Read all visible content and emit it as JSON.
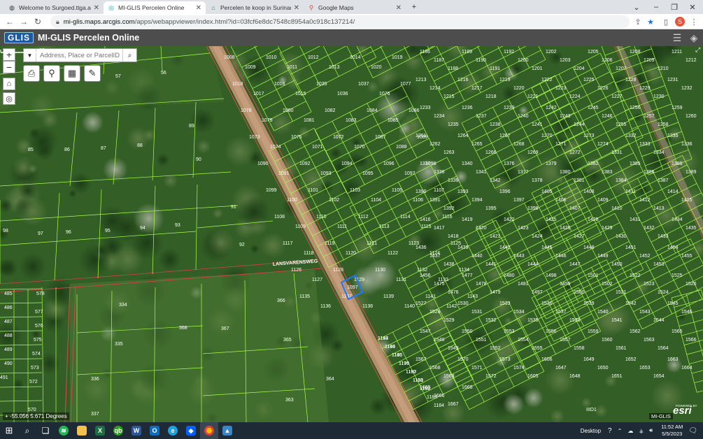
{
  "browser": {
    "tabs": [
      {
        "label": "Welcome to Surgoed.ttga.app",
        "icon": "globe-icon"
      },
      {
        "label": "MI-GLIS Percelen Online",
        "icon": "arcgis-icon",
        "active": true
      },
      {
        "label": "Percelen te koop in Suriname • S",
        "icon": "home-icon"
      },
      {
        "label": "Google Maps",
        "icon": "maps-pin-icon"
      }
    ],
    "url_host": "mi-glis.maps.arcgis.com",
    "url_path": "/apps/webappviewer/index.html?id=03fcf6e8dc7548c8954a0c918c137214/",
    "profile_initial": "S"
  },
  "app": {
    "logo": "GLIS",
    "title": "MI-GLIS Percelen Online"
  },
  "map": {
    "search_placeholder": "Address, Place or ParcelID",
    "road_label": "LANSVARENSWEG",
    "selected_parcel": "1097",
    "scale_label": "20m",
    "coordinates": "-55.056 5.671 Degrees",
    "credit": "MI-GLIS",
    "esri_powered": "POWERED BY",
    "esri": "esri",
    "corner_label": "IIID1",
    "parcel_labels_main": [
      "1008",
      "1009",
      "1010",
      "1011",
      "1012",
      "1013",
      "1014",
      "1020",
      "1019",
      "1018",
      "1017",
      "1016",
      "1015",
      "1035",
      "1036",
      "1037",
      "1076",
      "1077",
      "1078",
      "1079",
      "1080",
      "1081",
      "1082",
      "1083",
      "1084",
      "1085",
      "1086",
      "1073",
      "1074",
      "1075",
      "1071",
      "1072",
      "1070",
      "1087",
      "1088",
      "1089",
      "1090",
      "1091",
      "1092",
      "1093",
      "1094",
      "1095",
      "1096",
      "1097",
      "1098",
      "1099",
      "1100",
      "1101",
      "1102",
      "1103",
      "1104",
      "1105",
      "1106",
      "1107",
      "1108",
      "1109",
      "1110",
      "1111",
      "1112",
      "1113",
      "1114",
      "1115",
      "1116",
      "1117",
      "1118",
      "1119",
      "1120",
      "1121",
      "1122",
      "1123",
      "1124",
      "1125",
      "1126",
      "1127",
      "1128",
      "1129",
      "1130",
      "1131",
      "1132",
      "1133",
      "1134",
      "1135",
      "1136",
      "1137",
      "1138",
      "1139",
      "1140",
      "1141",
      "1142",
      "1143",
      "1144",
      "1145",
      "1146",
      "1179",
      "1180",
      "1181",
      "1182",
      "1183",
      "1184",
      "1193",
      "1194",
      "1195",
      "1196",
      "1197",
      "1198",
      "1199"
    ],
    "parcel_labels_east": [
      "1186",
      "1187",
      "1188",
      "1189",
      "1190",
      "1191",
      "1192",
      "1200",
      "1201",
      "1202",
      "1203",
      "1204",
      "1205",
      "1206",
      "1207",
      "1208",
      "1209",
      "1210",
      "1211",
      "1212",
      "1213",
      "1214",
      "1215",
      "1216",
      "1217",
      "1218",
      "1219",
      "1220",
      "1221",
      "1222",
      "1223",
      "1224",
      "1225",
      "1226",
      "1227",
      "1228",
      "1229",
      "1230",
      "1231",
      "1232",
      "1233",
      "1234",
      "1235",
      "1236",
      "1237",
      "1238",
      "1239",
      "1240",
      "1241",
      "1242",
      "1243",
      "1244",
      "1245",
      "1246",
      "1255",
      "1256",
      "1257",
      "1258",
      "1259",
      "1260",
      "1261",
      "1262",
      "1263",
      "1264",
      "1265",
      "1266",
      "1267",
      "1268",
      "1269",
      "1270",
      "1271",
      "1272",
      "1273",
      "1274",
      "1331",
      "1332",
      "1333",
      "1334",
      "1335",
      "1336",
      "1337",
      "1338",
      "1339",
      "1340",
      "1341",
      "1342",
      "1376",
      "1377",
      "1378",
      "1379",
      "1380",
      "1381",
      "1382",
      "1383",
      "1384",
      "1385",
      "1386",
      "1387",
      "1388",
      "1389",
      "1390",
      "1391",
      "1392",
      "1393",
      "1394",
      "1395",
      "1396",
      "1397",
      "1398",
      "1405",
      "1406",
      "1407",
      "1408",
      "1409",
      "1410",
      "1411",
      "1412",
      "1413",
      "1414",
      "1415",
      "1416",
      "1417",
      "1418",
      "1419",
      "1420",
      "1421",
      "1422",
      "1423",
      "1424",
      "1425",
      "1426",
      "1427",
      "1428",
      "1429",
      "1430",
      "1431",
      "1432",
      "1433",
      "1434",
      "1435",
      "1436",
      "1437",
      "1438",
      "1439",
      "1440",
      "1441",
      "1442",
      "1443",
      "1444",
      "1445",
      "1446",
      "1447",
      "1448",
      "1449",
      "1450",
      "1451",
      "1452",
      "1453",
      "1454",
      "1455",
      "1456",
      "1475",
      "1476",
      "1477",
      "1478",
      "1479",
      "1480",
      "1481",
      "1497",
      "1498",
      "1499",
      "1500",
      "1501",
      "1502",
      "1521",
      "1522",
      "1523",
      "1524",
      "1525",
      "1526",
      "1527",
      "1528",
      "1529",
      "1530",
      "1531",
      "1532",
      "1533",
      "1534",
      "1535",
      "1536",
      "1537",
      "1538",
      "1539",
      "1540",
      "1541",
      "1542",
      "1543",
      "1544",
      "1545",
      "1546",
      "1547",
      "1548",
      "1549",
      "1550",
      "1551",
      "1552",
      "1553",
      "1554",
      "1555",
      "1556",
      "1557",
      "1558",
      "1559",
      "1560",
      "1561",
      "1562",
      "1563",
      "1564",
      "1565",
      "1566",
      "1567",
      "1568",
      "1569",
      "1570",
      "1571",
      "1572",
      "1573",
      "1574",
      "1605",
      "1606",
      "1647",
      "1648",
      "1649",
      "1650",
      "1651",
      "1652",
      "1653",
      "1654",
      "1663",
      "1664",
      "1665",
      "1666",
      "1667",
      "1668"
    ],
    "parcel_labels_west": [
      "56",
      "57",
      "85",
      "86",
      "87",
      "88",
      "89",
      "90",
      "91",
      "92",
      "93",
      "94",
      "95",
      "96",
      "97",
      "98",
      "334",
      "335",
      "336",
      "337",
      "363",
      "364",
      "365",
      "366",
      "367",
      "368",
      "485",
      "486",
      "487",
      "488",
      "489",
      "490",
      "491",
      "570",
      "572",
      "573",
      "574",
      "575",
      "576",
      "577",
      "578"
    ]
  },
  "taskbar": {
    "desktop_label": "Desktop",
    "time": "11:52 AM",
    "date": "5/5/2023"
  }
}
